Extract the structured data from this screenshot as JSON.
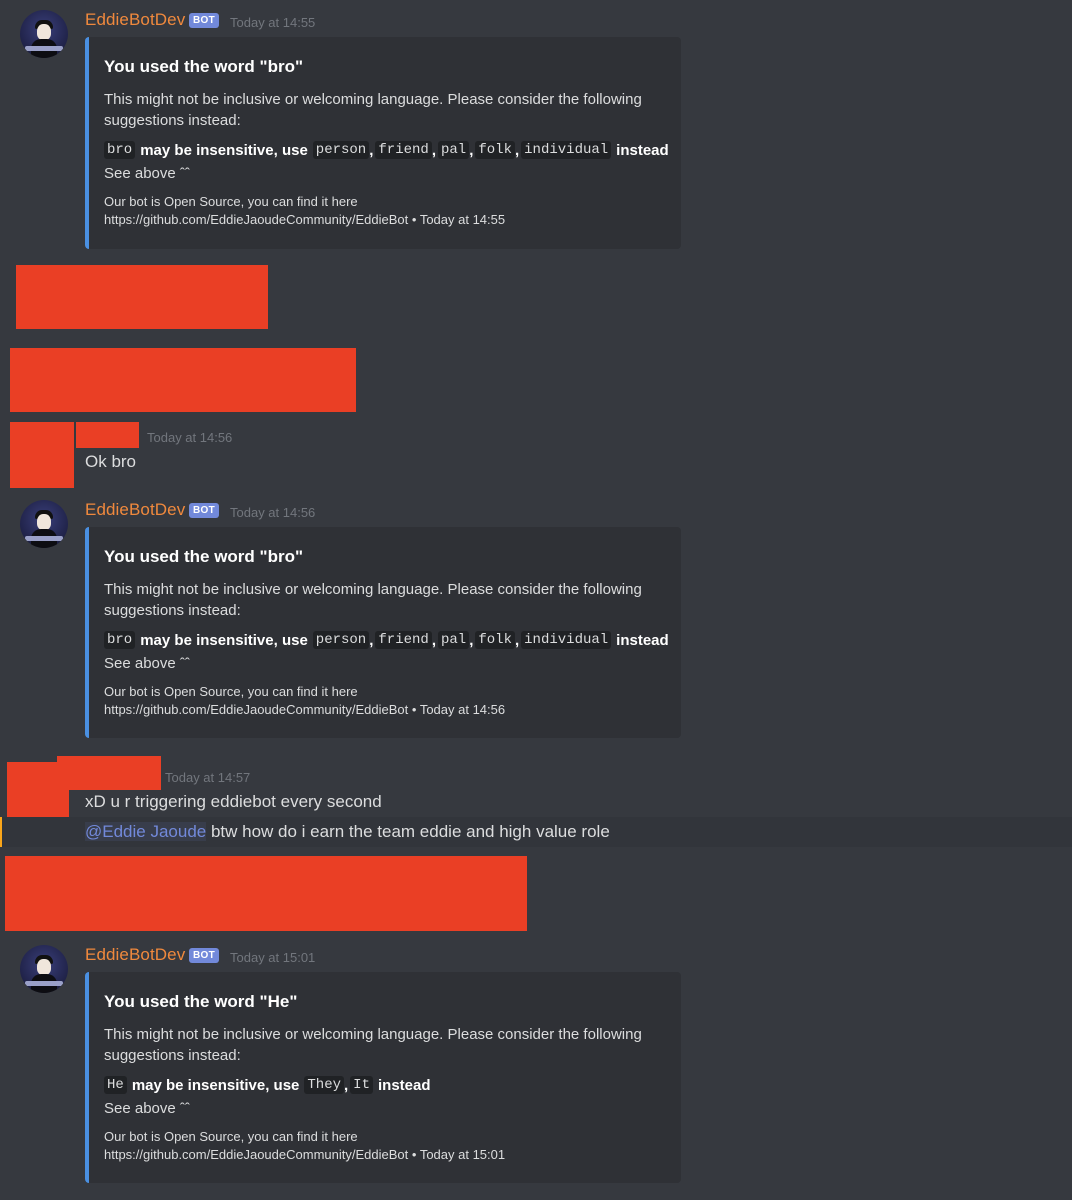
{
  "bot": {
    "name": "EddieBotDev",
    "tag": "BOT"
  },
  "messages": {
    "bot1": {
      "timestamp": "Today at 14:55",
      "embed": {
        "title": "You used the word \"bro\"",
        "description": "This might not be inclusive or welcoming language. Please consider the following suggestions instead:",
        "field_word": "bro",
        "field_mid": "may be insensitive, use",
        "field_suggestions": [
          "person",
          "friend",
          "pal",
          "folk",
          "individual"
        ],
        "field_end": "instead",
        "field_value": "See above ˆˆ",
        "footer_line1": "Our bot is Open Source, you can find it here",
        "footer_link": "https://github.com/EddieJaoudeCommunity/EddieBot",
        "footer_sep": "•",
        "footer_time": "Today at 14:55"
      }
    },
    "user1": {
      "timestamp": "Today at 14:56",
      "text": "Ok bro"
    },
    "bot2": {
      "timestamp": "Today at 14:56",
      "embed": {
        "title": "You used the word \"bro\"",
        "description": "This might not be inclusive or welcoming language. Please consider the following suggestions instead:",
        "field_word": "bro",
        "field_mid": "may be insensitive, use",
        "field_suggestions": [
          "person",
          "friend",
          "pal",
          "folk",
          "individual"
        ],
        "field_end": "instead",
        "field_value": "See above ˆˆ",
        "footer_line1": "Our bot is Open Source, you can find it here",
        "footer_link": "https://github.com/EddieJaoudeCommunity/EddieBot",
        "footer_sep": "•",
        "footer_time": "Today at 14:56"
      }
    },
    "user2": {
      "timestamp": "Today at 14:57",
      "text1": "xD u r triggering eddiebot every second",
      "mention": "@Eddie Jaoude",
      "text2": " btw how do i earn the team eddie and high value role"
    },
    "bot3": {
      "timestamp": "Today at 15:01",
      "embed": {
        "title": "You used the word \"He\"",
        "description": "This might not be inclusive or welcoming language. Please consider the following suggestions instead:",
        "field_word": "He",
        "field_mid": "may be insensitive, use",
        "field_suggestions": [
          "They",
          "It"
        ],
        "field_end": "instead",
        "field_value": "See above ˆˆ",
        "footer_line1": "Our bot is Open Source, you can find it here",
        "footer_link": "https://github.com/EddieJaoudeCommunity/EddieBot",
        "footer_sep": "•",
        "footer_time": "Today at 15:01"
      }
    }
  },
  "colors": {
    "background": "#36393f",
    "embed_bg": "#2f3136",
    "embed_border": "#4a90e2",
    "username": "#f0893d",
    "bot_tag": "#7289da",
    "redaction": "#ea3f25",
    "mention": "#7289da"
  }
}
